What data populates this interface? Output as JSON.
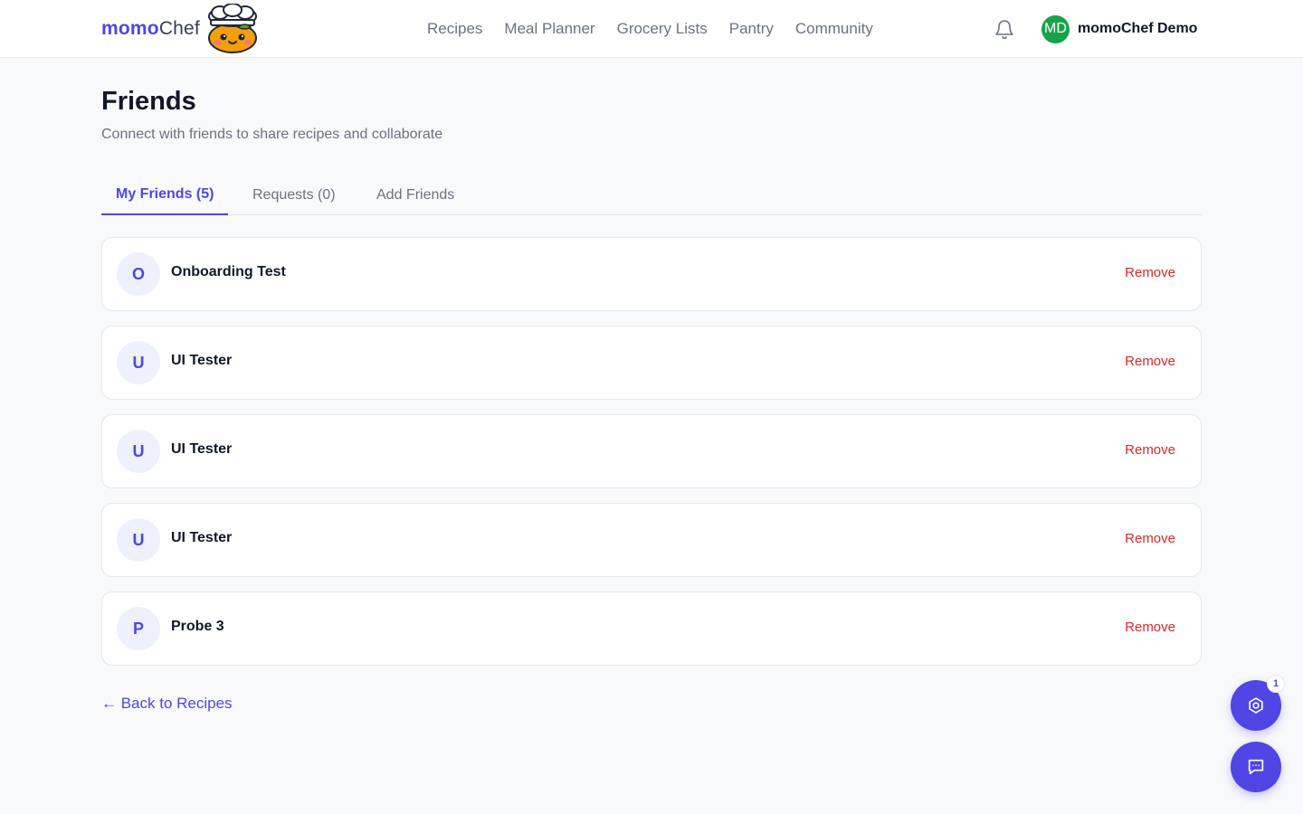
{
  "header": {
    "brand_primary": "momo",
    "brand_secondary": "Chef",
    "nav": [
      "Recipes",
      "Meal Planner",
      "Grocery Lists",
      "Pantry",
      "Community"
    ],
    "user_initials": "MD",
    "user_name": "momoChef Demo"
  },
  "page": {
    "title": "Friends",
    "subtitle": "Connect with friends to share recipes and collaborate"
  },
  "tabs": [
    "My Friends (5)",
    "Requests (0)",
    "Add Friends"
  ],
  "friends": [
    {
      "initial": "O",
      "name": "Onboarding Test",
      "action": "Remove"
    },
    {
      "initial": "U",
      "name": "UI Tester",
      "action": "Remove"
    },
    {
      "initial": "U",
      "name": "UI Tester",
      "action": "Remove"
    },
    {
      "initial": "U",
      "name": "UI Tester",
      "action": "Remove"
    },
    {
      "initial": "P",
      "name": "Probe 3",
      "action": "Remove"
    }
  ],
  "back_link": "← Back to Recipes",
  "fab": {
    "settings_badge": "1",
    "settings_icon": "settings-icon",
    "chat_icon": "chat-icon"
  },
  "colors": {
    "accent": "#4f46e5",
    "danger": "#dc2626",
    "avatar_user": "#16a34a"
  }
}
